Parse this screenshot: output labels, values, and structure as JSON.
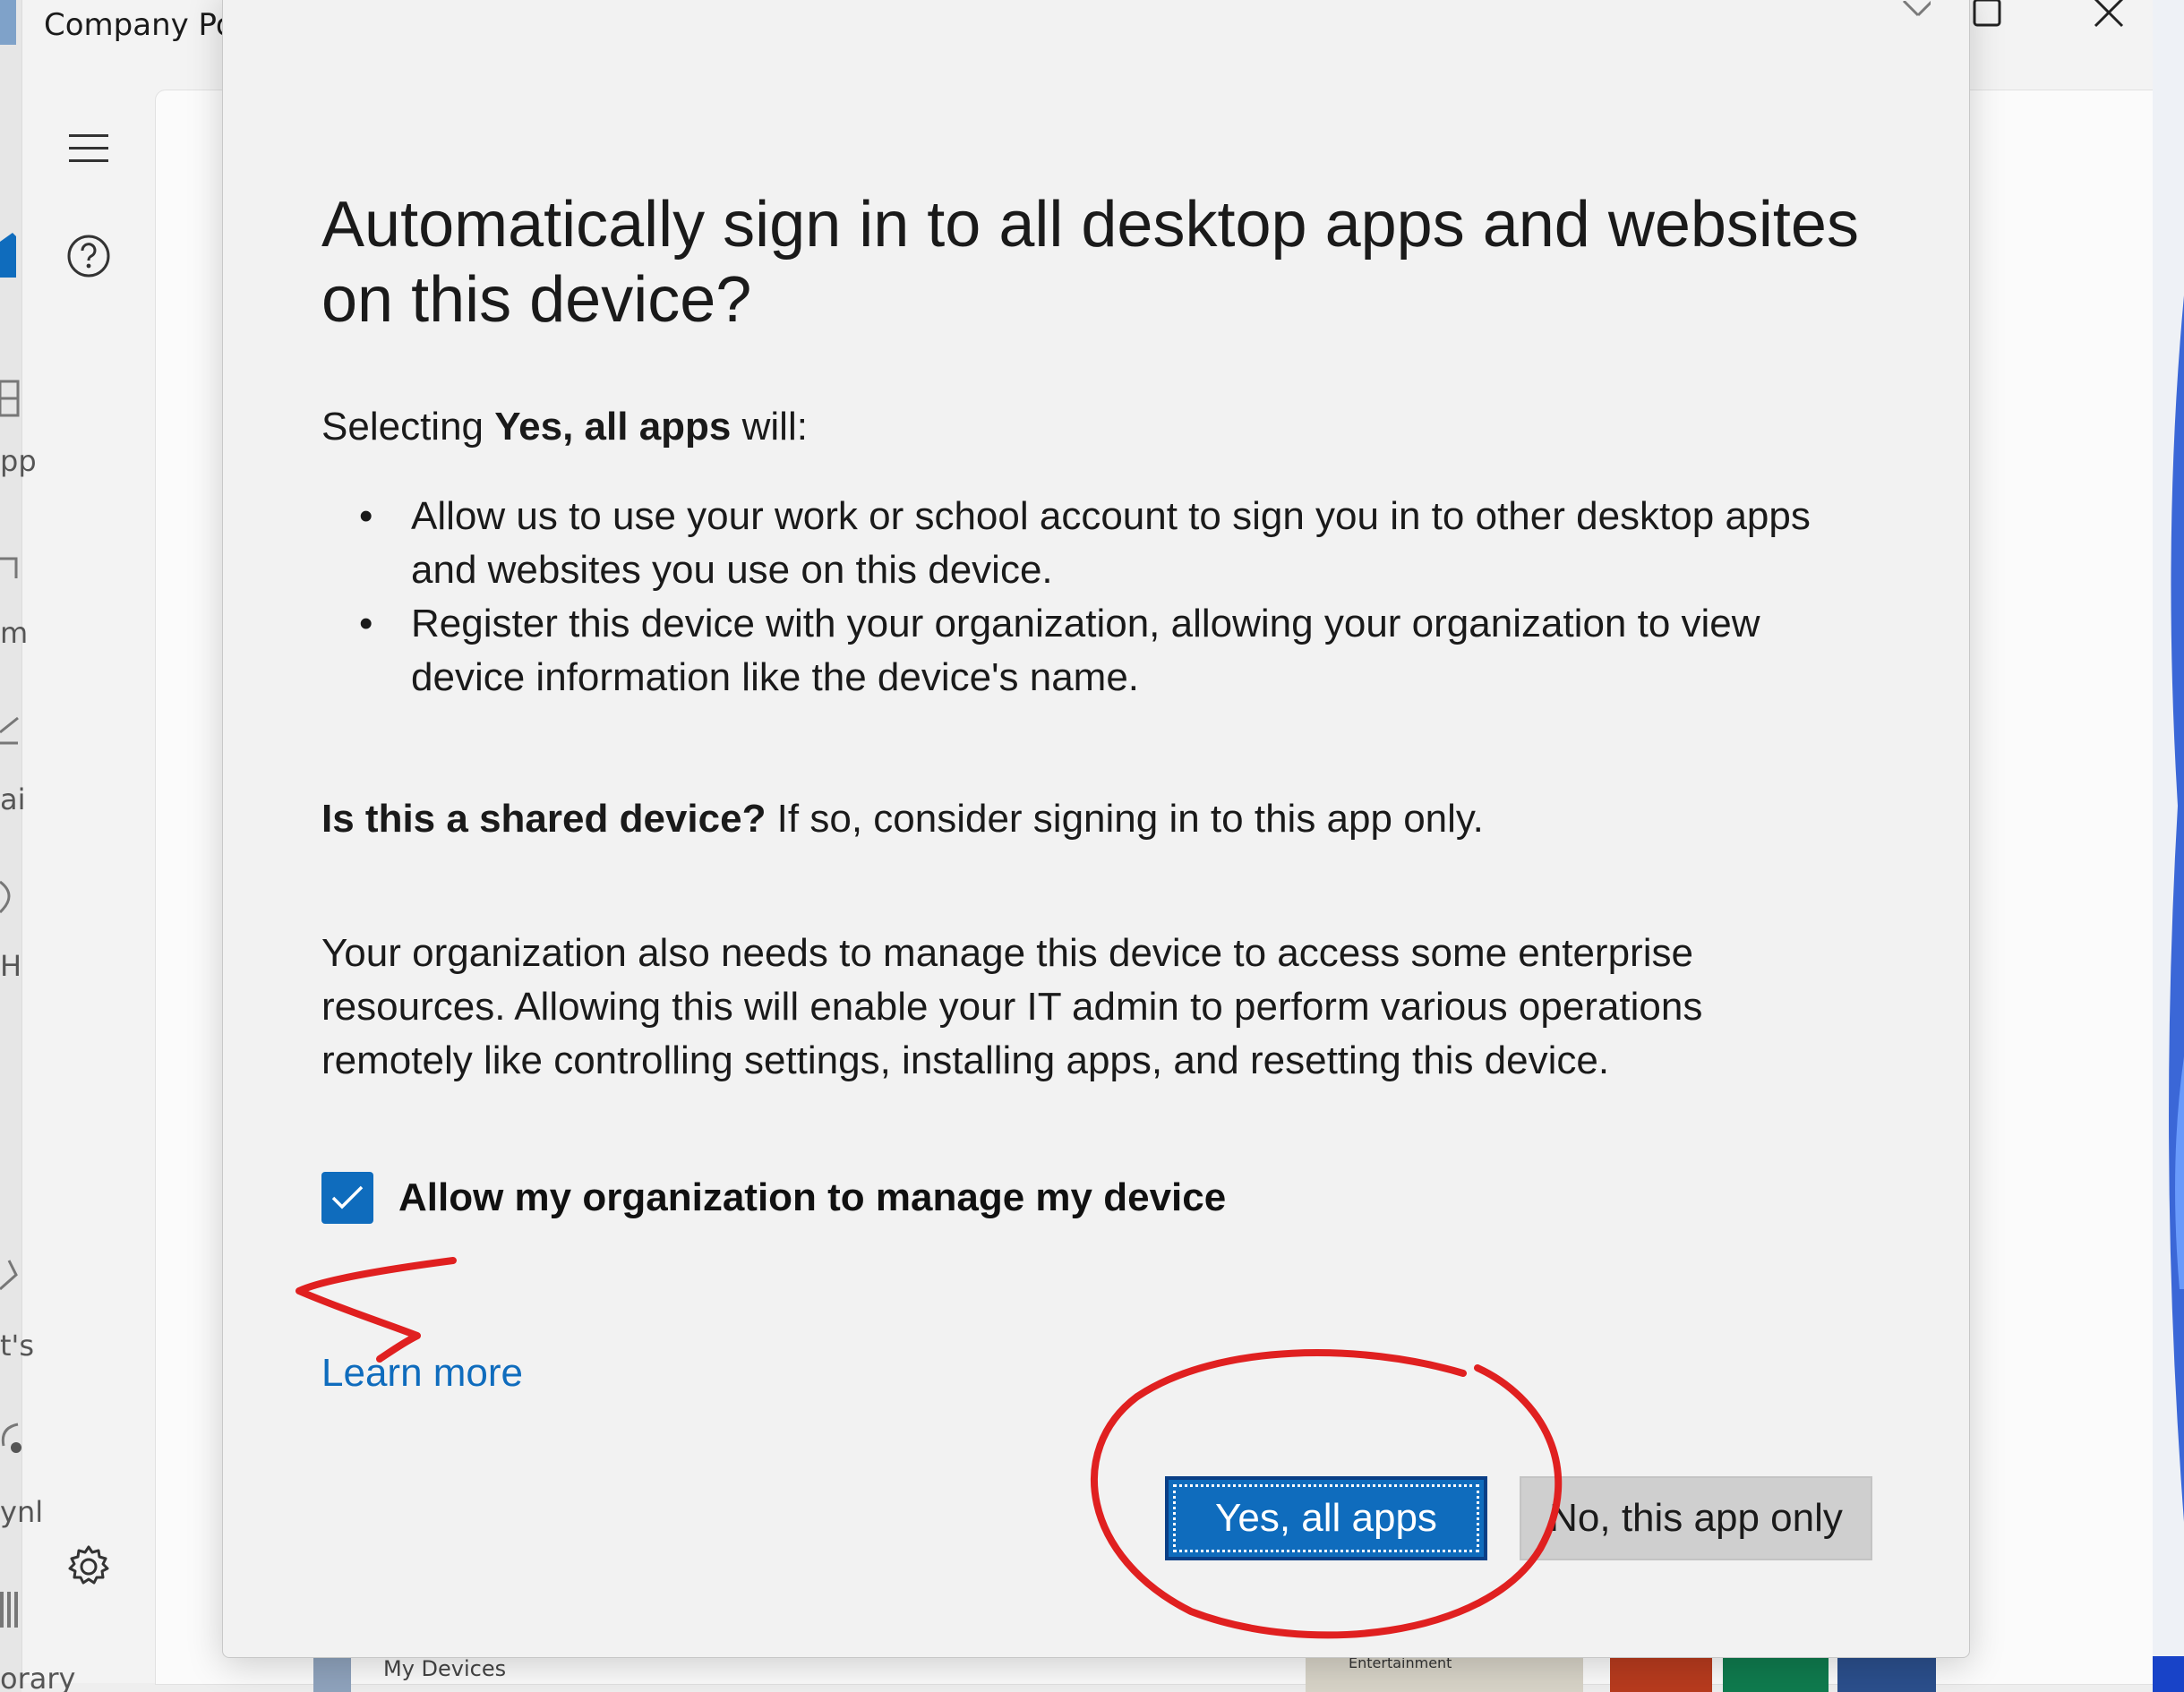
{
  "app": {
    "title": "Company Po"
  },
  "behind_window": {
    "edge_labels": [
      "pp",
      "m",
      "ai",
      "H",
      "t's",
      "ynl",
      "orary"
    ],
    "bottom_label": "My Devices",
    "tile_label": "Entertainment"
  },
  "dialog": {
    "title": "Automatically sign in to all desktop apps and websites on this device?",
    "intro_prefix": "Selecting ",
    "intro_bold": "Yes, all apps",
    "intro_suffix": " will:",
    "bullets": [
      "Allow us to use your work or school account to sign you in to other desktop apps and websites you use on this device.",
      "Register this device with your organization, allowing your organization to view device information like the device's name."
    ],
    "shared_bold": "Is this a shared device?",
    "shared_text": " If so, consider signing in to this app only.",
    "manage_text": "Your organization also needs to manage this device to access some enterprise resources. Allowing this will enable your IT admin to perform various operations remotely like controlling settings, installing apps, and resetting this device.",
    "checkbox": {
      "label": "Allow my organization to manage my device",
      "checked": true
    },
    "learn_more": "Learn more",
    "buttons": {
      "primary": "Yes, all apps",
      "secondary": "No, this app only"
    }
  },
  "colors": {
    "accent": "#0f6cbd",
    "annotation": "#e02020"
  },
  "icons": {
    "menu": "hamburger-icon",
    "help": "help-icon",
    "settings": "gear-icon",
    "close": "close-icon",
    "maximize": "maximize-icon",
    "check": "checkmark-icon"
  }
}
